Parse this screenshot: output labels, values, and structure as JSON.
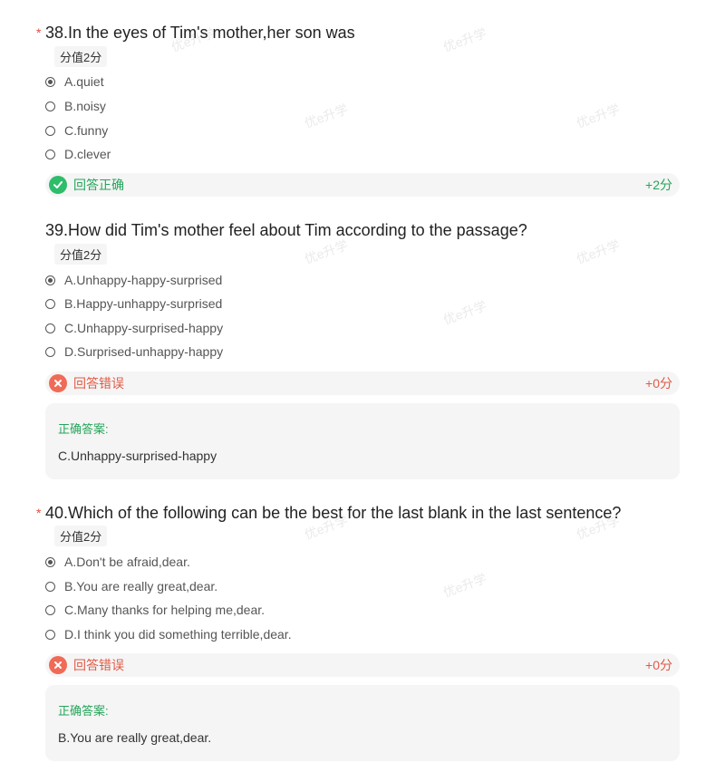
{
  "watermark": "优e升学",
  "questions": [
    {
      "title": "38.In the eyes of Tim's mother,her son was",
      "required_mark": "*",
      "score_tag": "分值2分",
      "options": [
        "A.quiet",
        "B.noisy",
        "C.funny",
        "D.clever"
      ],
      "selected": "A",
      "result_label": "回答正确",
      "result_points": "+2分"
    },
    {
      "title": "39.How did Tim's mother feel about Tim according to the passage?",
      "required_mark": "",
      "score_tag": "分值2分",
      "options": [
        "A.Unhappy-happy-surprised",
        "B.Happy-unhappy-surprised",
        "C.Unhappy-surprised-happy",
        "D.Surprised-unhappy-happy"
      ],
      "selected": "A",
      "result_label": "回答错误",
      "result_points": "+0分",
      "correct_answer_title": "正确答案:",
      "correct_answer": "C.Unhappy-surprised-happy"
    },
    {
      "title": "40.Which of the following can be the best for the last blank in the last sentence?",
      "required_mark": "*",
      "score_tag": "分值2分",
      "options": [
        "A.Don't be afraid,dear.",
        "B.You are really great,dear.",
        "C.Many thanks for helping me,dear.",
        "D.I think you did something terrible,dear."
      ],
      "selected": "A",
      "result_label": "回答错误",
      "result_points": "+0分",
      "correct_answer_title": "正确答案:",
      "correct_answer": "B.You are really great,dear."
    }
  ],
  "colors": {
    "correct": "#2ebd6b",
    "wrong": "#f06b57",
    "required": "#e64a3b"
  }
}
